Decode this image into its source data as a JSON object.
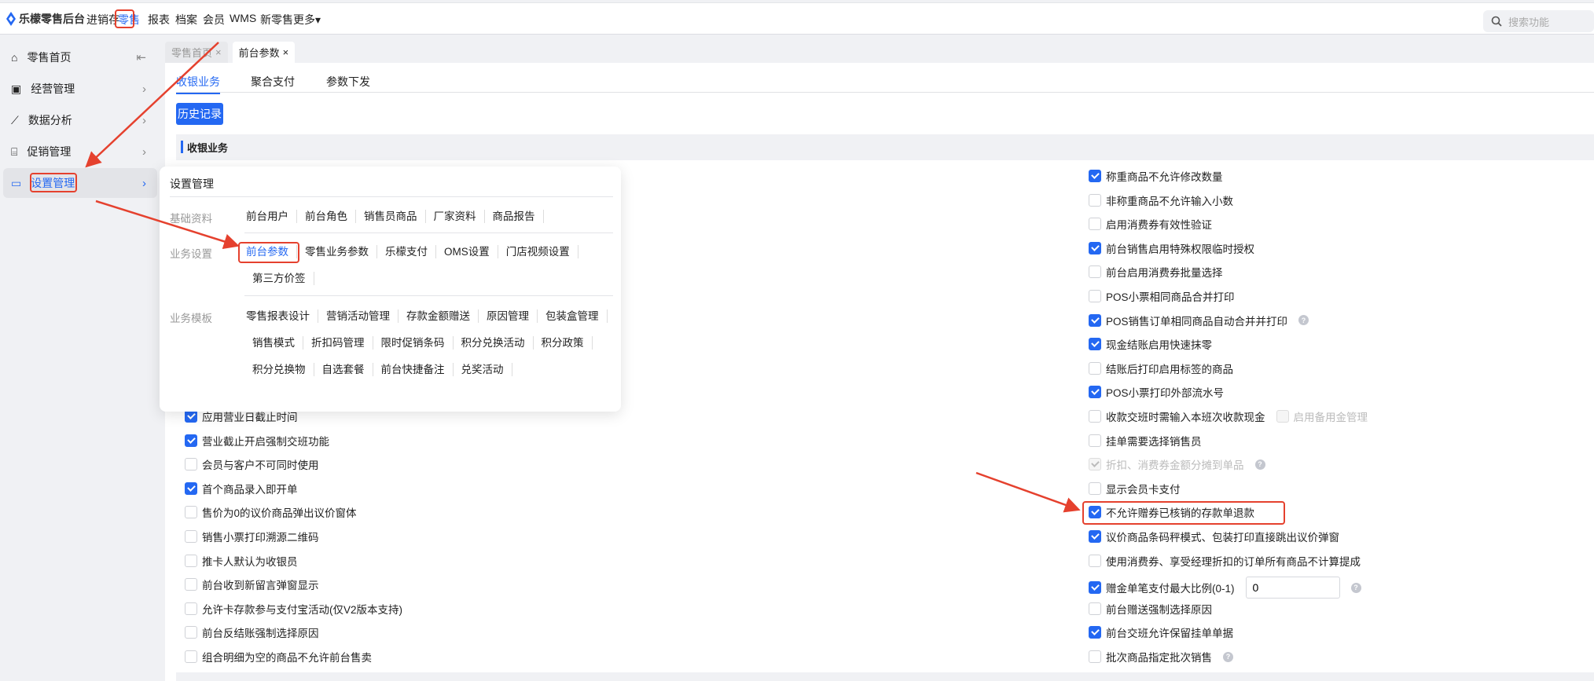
{
  "app": {
    "title": "乐檬零售后台",
    "brand_color": "#2468f2",
    "annotation_color": "#e5412e"
  },
  "top_nav": [
    {
      "label": "进销存",
      "active": false
    },
    {
      "label": "零售",
      "active": true
    },
    {
      "label": "报表",
      "active": false
    },
    {
      "label": "档案",
      "active": false
    },
    {
      "label": "会员",
      "active": false
    },
    {
      "label": "WMS",
      "active": false
    },
    {
      "label": "新零售",
      "active": false
    },
    {
      "label": "更多▾",
      "active": false
    }
  ],
  "search": {
    "placeholder": "搜索功能"
  },
  "sidebar": [
    {
      "label": "零售首页",
      "icon": "home-icon",
      "trail": "collapse-icon"
    },
    {
      "label": "经营管理",
      "icon": "monitor-icon"
    },
    {
      "label": "数据分析",
      "icon": "chart-icon"
    },
    {
      "label": "促销管理",
      "icon": "coupon-icon"
    },
    {
      "label": "设置管理",
      "icon": "folder-icon",
      "active": true
    }
  ],
  "tabs": [
    {
      "label": "零售首页",
      "close": "×",
      "active": false
    },
    {
      "label": "前台参数",
      "close": "×",
      "active": true
    }
  ],
  "subtabs": [
    {
      "label": "收银业务",
      "active": true
    },
    {
      "label": "聚合支付"
    },
    {
      "label": "参数下发"
    }
  ],
  "history_button": "历史记录",
  "section_title": "收银业务",
  "popup": {
    "title": "设置管理",
    "groups": [
      {
        "label": "基础资料",
        "items": [
          "前台用户",
          "前台角色",
          "销售员商品",
          "厂家资料",
          "商品报告"
        ]
      },
      {
        "label": "业务设置",
        "items": [
          "前台参数",
          "零售业务参数",
          "乐檬支付",
          "OMS设置",
          "门店视频设置",
          "第三方价签"
        ],
        "active": "前台参数"
      },
      {
        "label": "业务模板",
        "items": [
          "零售报表设计",
          "营销活动管理",
          "存款金额赠送",
          "原因管理",
          "包装盒管理",
          "销售模式",
          "折扣码管理",
          "限时促销条码",
          "积分兑换活动",
          "积分政策",
          "积分兑换物",
          "自选套餐",
          "前台快捷备注",
          "兑奖活动"
        ]
      }
    ]
  },
  "left_options": [
    {
      "label": "应用营业日截止时间",
      "checked": true
    },
    {
      "label": "营业截止开启强制交班功能",
      "checked": true
    },
    {
      "label": "会员与客户不可同时使用",
      "checked": false
    },
    {
      "label": "首个商品录入即开单",
      "checked": true
    },
    {
      "label": "售价为0的议价商品弹出议价窗体",
      "checked": false
    },
    {
      "label": "销售小票打印溯源二维码",
      "checked": false
    },
    {
      "label": "推卡人默认为收银员",
      "checked": false
    },
    {
      "label": "前台收到新留言弹窗显示",
      "checked": false
    },
    {
      "label": "允许卡存款参与支付宝活动(仅V2版本支持)",
      "checked": false
    },
    {
      "label": "前台反结账强制选择原因",
      "checked": false
    },
    {
      "label": "组合明细为空的商品不允许前台售卖",
      "checked": false
    }
  ],
  "right_options": [
    {
      "label": "称重商品不允许修改数量",
      "checked": true
    },
    {
      "label": "非称重商品不允许输入小数",
      "checked": false
    },
    {
      "label": "启用消费券有效性验证",
      "checked": false
    },
    {
      "label": "前台销售启用特殊权限临时授权",
      "checked": true
    },
    {
      "label": "前台启用消费券批量选择",
      "checked": false
    },
    {
      "label": "POS小票相同商品合并打印",
      "checked": false
    },
    {
      "label": "POS销售订单相同商品自动合并并打印",
      "checked": true,
      "help": "?"
    },
    {
      "label": "现金结账启用快速抹零",
      "checked": true
    },
    {
      "label": "结账后打印启用标签的商品",
      "checked": false
    },
    {
      "label": "POS小票打印外部流水号",
      "checked": true
    },
    {
      "label": "收款交班时需输入本班次收款现金",
      "checked": false,
      "extra_label": "启用备用金管理"
    },
    {
      "label": "挂单需要选择销售员",
      "checked": false
    },
    {
      "label": "折扣、消费券金额分摊到单品",
      "checked": true,
      "disabled": true,
      "help": "?"
    },
    {
      "label": "显示会员卡支付",
      "checked": false
    },
    {
      "label": "不允许赠券已核销的存款单退款",
      "checked": true,
      "highlight": true
    },
    {
      "label": "议价商品条码秤模式、包装打印直接跳出议价弹窗",
      "checked": true
    },
    {
      "label": "使用消费券、享受经理折扣的订单所有商品不计算提成",
      "checked": false
    },
    {
      "label": "赠金单笔支付最大比例(0-1)",
      "checked": true,
      "input_value": "0",
      "help": "?"
    },
    {
      "label": "前台赠送强制选择原因",
      "checked": false
    },
    {
      "label": "前台交班允许保留挂单单据",
      "checked": true
    },
    {
      "label": "批次商品指定批次销售",
      "checked": false,
      "help": "?"
    }
  ]
}
